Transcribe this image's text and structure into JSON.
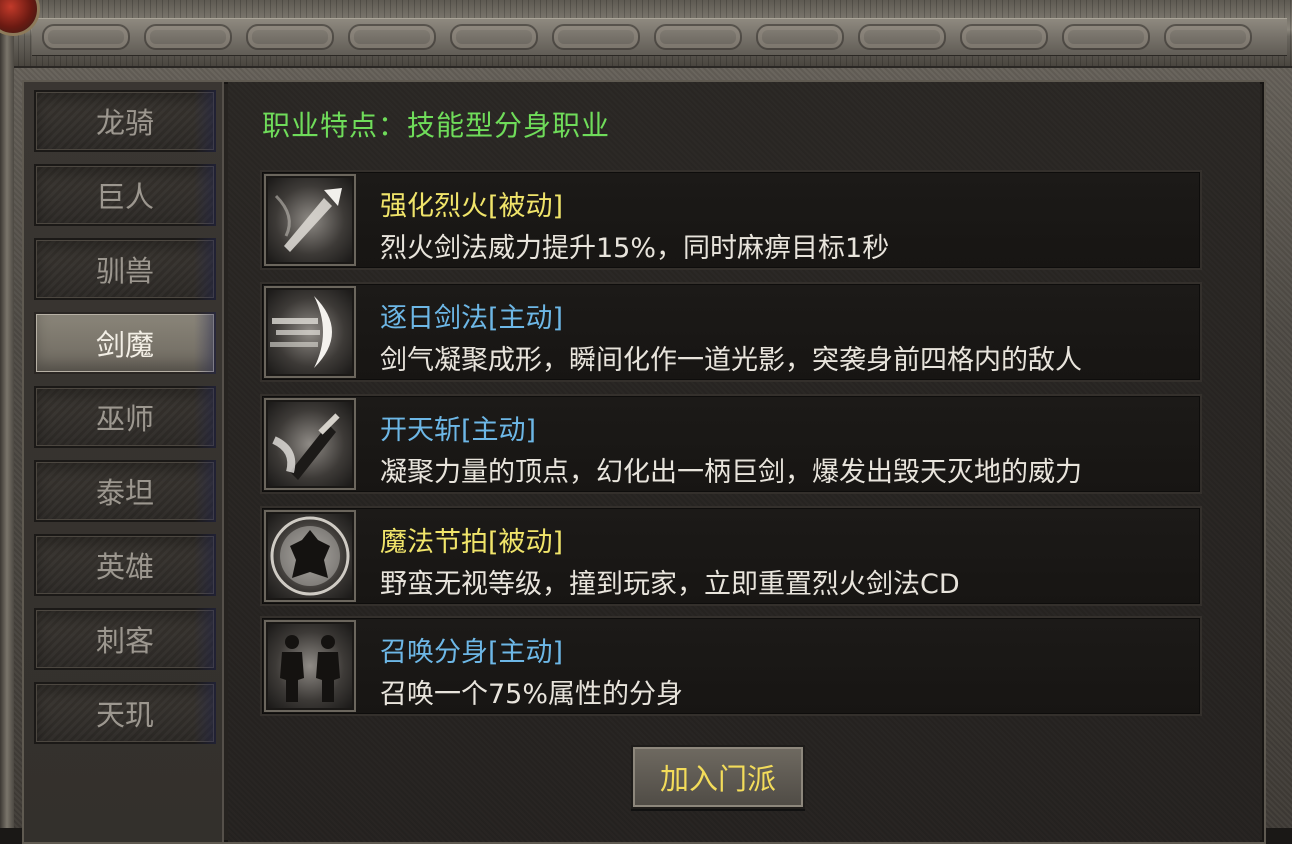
{
  "sidebar": {
    "items": [
      {
        "label": "龙骑",
        "active": false
      },
      {
        "label": "巨人",
        "active": false
      },
      {
        "label": "驯兽",
        "active": false
      },
      {
        "label": "剑魔",
        "active": true
      },
      {
        "label": "巫师",
        "active": false
      },
      {
        "label": "泰坦",
        "active": false
      },
      {
        "label": "英雄",
        "active": false
      },
      {
        "label": "刺客",
        "active": false
      },
      {
        "label": "天玑",
        "active": false
      }
    ]
  },
  "main": {
    "class_trait": "职业特点：技能型分身职业",
    "skills": [
      {
        "name": "强化烈火[被动]",
        "type": "passive",
        "desc": "烈火剑法威力提升15%，同时麻痹目标1秒",
        "icon": "spear-strike-icon"
      },
      {
        "name": "逐日剑法[主动]",
        "type": "active",
        "desc": "剑气凝聚成形，瞬间化作一道光影，突袭身前四格内的敌人",
        "icon": "light-wave-icon"
      },
      {
        "name": "开天斩[主动]",
        "type": "active",
        "desc": "凝聚力量的顶点，幻化出一柄巨剑，爆发出毁天灭地的威力",
        "icon": "giant-sword-icon"
      },
      {
        "name": "魔法节拍[被动]",
        "type": "passive",
        "desc": "野蛮无视等级，撞到玩家，立即重置烈火剑法CD",
        "icon": "warrior-silhouette-icon"
      },
      {
        "name": "召唤分身[主动]",
        "type": "active",
        "desc": "召唤一个75%属性的分身",
        "icon": "clone-figures-icon"
      }
    ],
    "join_button": "加入门派"
  },
  "colors": {
    "trait_green": "#6fdc5a",
    "passive_yellow": "#f0e46a",
    "active_blue": "#6db7e6",
    "button_text": "#f3dc5a"
  }
}
